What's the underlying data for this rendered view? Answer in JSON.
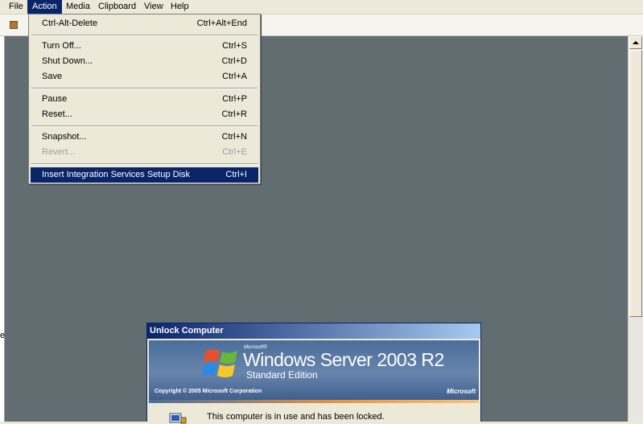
{
  "menubar": {
    "items": [
      {
        "label": "File"
      },
      {
        "label": "Action"
      },
      {
        "label": "Media"
      },
      {
        "label": "Clipboard"
      },
      {
        "label": "View"
      },
      {
        "label": "Help"
      }
    ],
    "active": "Action"
  },
  "action_menu": {
    "items": [
      {
        "label": "Ctrl-Alt-Delete",
        "shortcut": "Ctrl+Alt+End",
        "enabled": true
      },
      {
        "label": "Turn Off...",
        "shortcut": "Ctrl+S",
        "enabled": true
      },
      {
        "label": "Shut Down...",
        "shortcut": "Ctrl+D",
        "enabled": true
      },
      {
        "label": "Save",
        "shortcut": "Ctrl+A",
        "enabled": true
      },
      {
        "label": "Pause",
        "shortcut": "Ctrl+P",
        "enabled": true
      },
      {
        "label": "Reset...",
        "shortcut": "Ctrl+R",
        "enabled": true
      },
      {
        "label": "Snapshot...",
        "shortcut": "Ctrl+N",
        "enabled": true
      },
      {
        "label": "Revert...",
        "shortcut": "Ctrl+E",
        "enabled": false
      },
      {
        "label": "Insert Integration Services Setup Disk",
        "shortcut": "Ctrl+I",
        "enabled": true,
        "highlighted": true
      }
    ]
  },
  "toolbar": {
    "icon": "stop-icon",
    "icon_color": "#b07a2a"
  },
  "vm": {
    "background": "#626d72"
  },
  "dialog": {
    "title": "Unlock Computer",
    "banner": {
      "brand_small": "Microsoft®",
      "product": "Windows Server 2003 R2",
      "edition": "Standard Edition",
      "copyright": "Copyright © 2005  Microsoft Corporation",
      "logo": "Microsoft"
    },
    "message": "This computer is in use and has been locked.",
    "icon": "lock-computer-icon"
  },
  "edge_text": "e"
}
